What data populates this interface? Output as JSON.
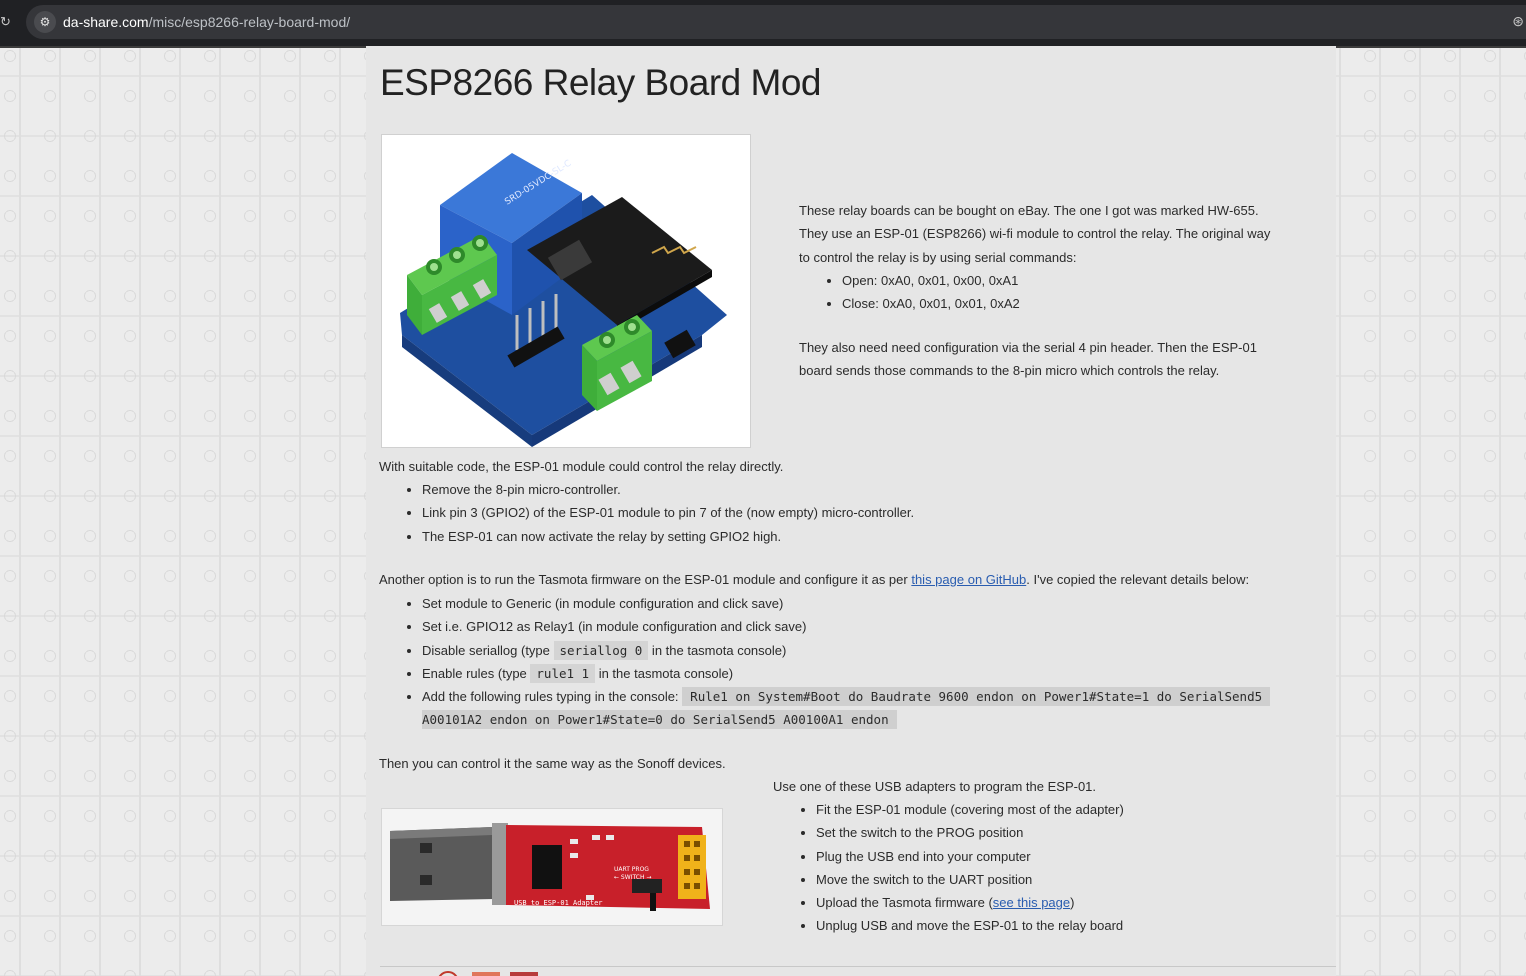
{
  "browser": {
    "url_host": "da-share.com",
    "url_path": "/misc/esp8266-relay-board-mod/"
  },
  "page": {
    "title": "ESP8266 Relay Board Mod",
    "intro_1": "These relay boards can be bought on eBay. The one I got was marked HW-655.",
    "intro_2": "They use an ESP-01 (ESP8266) wi-fi module to control the relay. The original way",
    "intro_3": "to control the relay is by using serial commands:",
    "serial_cmds": [
      "Open:  0xA0, 0x01, 0x00, 0xA1",
      "Close: 0xA0, 0x01, 0x01, 0xA2"
    ],
    "config_1": "They also need need configuration via the serial 4 pin header. Then the ESP-01",
    "config_2": "board sends those commands to the 8-pin micro which controls the relay.",
    "suitable": "With suitable code, the ESP-01 module could control the relay directly.",
    "direct_steps": [
      "Remove the 8-pin micro-controller.",
      "Link pin 3 (GPIO2) of the ESP-01 module to pin 7 of the (now empty) micro-controller.",
      "The ESP-01 can now activate the relay by setting GPIO2 high."
    ],
    "tasmota_pre": "Another option is to run the Tasmota firmware on the ESP-01 module and configure it as per ",
    "tasmota_link": "this page on GitHub",
    "tasmota_post": ". I've copied the relevant details below:",
    "tasmota_steps": {
      "s1": "Set module to Generic (in module configuration and click save)",
      "s2": "Set i.e. GPIO12 as Relay1 (in module configuration and click save)",
      "s3_pre": "Disable seriallog (type ",
      "s3_code": "seriallog 0",
      "s3_post": " in the tasmota console)",
      "s4_pre": "Enable rules (type ",
      "s4_code": "rule1 1",
      "s4_post": " in the tasmota console)",
      "s5_pre": "Add the following rules typing in the console: ",
      "s5_code_1": "Rule1 on System#Boot do Baudrate 9600 endon on Power1#State=1 do SerialSend5",
      "s5_code_2": "A00101A2 endon on Power1#State=0 do SerialSend5 A00100A1 endon"
    },
    "sonoff": "Then you can control it the same way as the Sonoff devices.",
    "usb_intro": "Use one of these USB adapters to program the ESP-01.",
    "usb_steps": {
      "u1": "Fit the ESP-01 module (covering most of the adapter)",
      "u2": "Set the switch to the PROG position",
      "u3": "Plug the USB end into your computer",
      "u4": "Move the switch to the UART position",
      "u5_pre": "Upload the Tasmota firmware (",
      "u5_link": "see this page",
      "u5_post": ")",
      "u6": "Unplug USB and move the ESP-01 to the relay board"
    },
    "usb_board_label": "USB to ESP-01 Adapter",
    "usb_board_switch": "UART  PROG",
    "usb_board_switch2": "← SWITCH →"
  },
  "colors": {
    "link": "#2a5db0",
    "relay_blue": "#2b63c9",
    "terminal_green": "#3fae3a",
    "pcb_blue": "#1e4fa0",
    "adapter_red": "#c8202a"
  }
}
